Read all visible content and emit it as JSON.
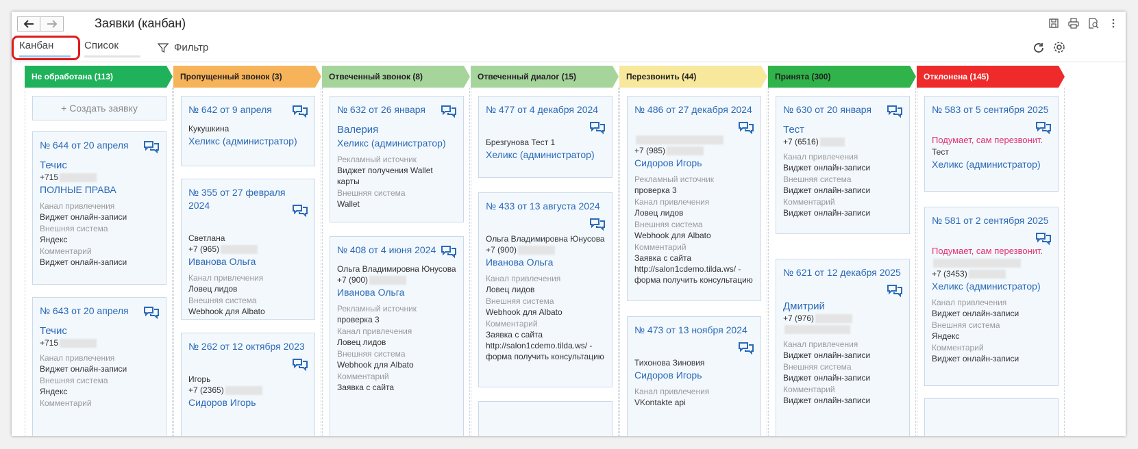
{
  "window": {
    "title": "Заявки (канбан)"
  },
  "tabs": {
    "kanban": "Канбан",
    "list": "Список",
    "filter": "Фильтр"
  },
  "colors": {
    "new": "#1fb25a",
    "missed": "#f7b35a",
    "answered_call": "#a6d59c",
    "answered_dialog": "#a6d59c",
    "callback": "#f8e89c",
    "accepted": "#2fb34a",
    "rejected": "#ee2a2a",
    "link": "#2a6ab8",
    "warn": "#e0316e"
  },
  "columns": [
    {
      "header": "Не обработана (113)",
      "create": "+ Создать заявку",
      "cards": [
        {
          "title": "№ 644 от 20 апреля",
          "name": "Течис",
          "phone": "+715",
          "rights": "ПОЛНЫЕ ПРАВА",
          "l1": "Канал привлечения",
          "v1": "Виджет онлайн-записи",
          "l2": "Внешняя система",
          "v2": "Яндекс",
          "l3": "Комментарий",
          "v3": "Виджет онлайн-записи"
        },
        {
          "title": "№ 643 от 20 апреля",
          "name": "Течис",
          "phone": "+715",
          "l1": "Канал привлечения",
          "v1": "Виджет онлайн-записи",
          "l2": "Внешняя система",
          "v2": "Яндекс",
          "l3": "Комментарий"
        }
      ]
    },
    {
      "header": "Пропущенный звонок (3)",
      "cards": [
        {
          "title": "№ 642 от 9 апреля",
          "client": "Кукушкина",
          "manager": "Хеликс (администратор)"
        },
        {
          "title": "№ 355 от 27 февраля 2024",
          "client": "Светлана",
          "phone": "+7 (965)",
          "manager": "Иванова Ольга",
          "l1": "Канал привлечения",
          "v1": "Ловец лидов",
          "l2": "Внешняя система",
          "v2": "Webhook для Albato"
        },
        {
          "title": "№ 262 от 12 октября 2023",
          "client": "Игорь",
          "phone": "+7 (2365)",
          "manager": "Сидоров Игорь"
        }
      ]
    },
    {
      "header": "Отвеченный звонок (8)",
      "cards": [
        {
          "title": "№ 632 от 26 января",
          "name": "Валерия",
          "manager": "Хеликс (администратор)",
          "l1": "Рекламный источник",
          "v1": "Виджет получения Wallet карты",
          "l2": "Внешняя система",
          "v2": "Wallet"
        },
        {
          "title": "№ 408 от 4 июня 2024",
          "client": "Ольга Владимировна Юнусова",
          "phone": "+7 (900)",
          "manager": "Иванова Ольга",
          "l1": "Рекламный источник",
          "v1": "проверка 3",
          "l2": "Канал привлечения",
          "v2": "Ловец лидов",
          "l3": "Внешняя система",
          "v3": "Webhook для Albato",
          "l4": "Комментарий",
          "v4": "Заявка с сайта"
        }
      ]
    },
    {
      "header": "Отвеченный диалог (15)",
      "cards": [
        {
          "title": "№ 477 от 4 декабря 2024",
          "client": "Брезгунова Тест 1",
          "manager": "Хеликс (администратор)"
        },
        {
          "title": "№ 433 от 13 августа 2024",
          "client": "Ольга Владимировна Юнусова",
          "phone": "+7 (900)",
          "manager": "Иванова Ольга",
          "l1": "Канал привлечения",
          "v1": "Ловец лидов",
          "l2": "Внешняя система",
          "v2": "Webhook для Albato",
          "l3": "Комментарий",
          "v3": "Заявка с сайта http://salon1cdemo.tilda.ws/ - форма получить консультацию"
        }
      ]
    },
    {
      "header": "Перезвонить (44)",
      "cards": [
        {
          "title": "№ 486 от 27 декабря 2024",
          "phone": "+7 (985)",
          "manager": "Сидоров Игорь",
          "l1": "Рекламный источник",
          "v1": "проверка 3",
          "l2": "Канал привлечения",
          "v2": "Ловец лидов",
          "l3": "Внешняя система",
          "v3": "Webhook для Albato",
          "l4": "Комментарий",
          "v4": "Заявка с сайта http://salon1cdemo.tilda.ws/ - форма получить консультацию"
        },
        {
          "title": "№ 473 от 13 ноября 2024",
          "client": "Тихонова Зиновия",
          "manager": "Сидоров Игорь",
          "l1": "Канал привлечения",
          "v1": "VKontakte api"
        }
      ]
    },
    {
      "header": "Принята (300)",
      "cards": [
        {
          "title": "№ 630 от 20 января",
          "name": "Тест",
          "phone": "+7 (6516)",
          "l1": "Канал привлечения",
          "v1": "Виджет онлайн-записи",
          "l2": "Внешняя система",
          "v2": "Виджет онлайн-записи",
          "l3": "Комментарий",
          "v3": "Виджет онлайн-записи"
        },
        {
          "title": "№ 621 от 12 декабря 2025",
          "name": "Дмитрий",
          "phone": "+7 (976)",
          "l1": "Канал привлечения",
          "v1": "Виджет онлайн-записи",
          "l2": "Внешняя система",
          "v2": "Виджет онлайн-записи",
          "l3": "Комментарий",
          "v3": "Виджет онлайн-записи"
        }
      ]
    },
    {
      "header": "Отклонена (145)",
      "cards": [
        {
          "title": "№ 583 от 5 сентября 2025",
          "warn": "Подумает, сам перезвонит.",
          "client": "Тест",
          "manager": "Хеликс (администратор)"
        },
        {
          "title": "№ 581 от 2 сентября 2025",
          "warn": "Подумает, сам перезвонит.",
          "phone": "+7 (3453)",
          "manager": "Хеликс (администратор)",
          "l1": "Канал привлечения",
          "v1": "Виджет онлайн-записи",
          "l2": "Внешняя система",
          "v2": "Яндекс",
          "l3": "Комментарий",
          "v3": "Виджет онлайн-записи"
        }
      ]
    }
  ]
}
